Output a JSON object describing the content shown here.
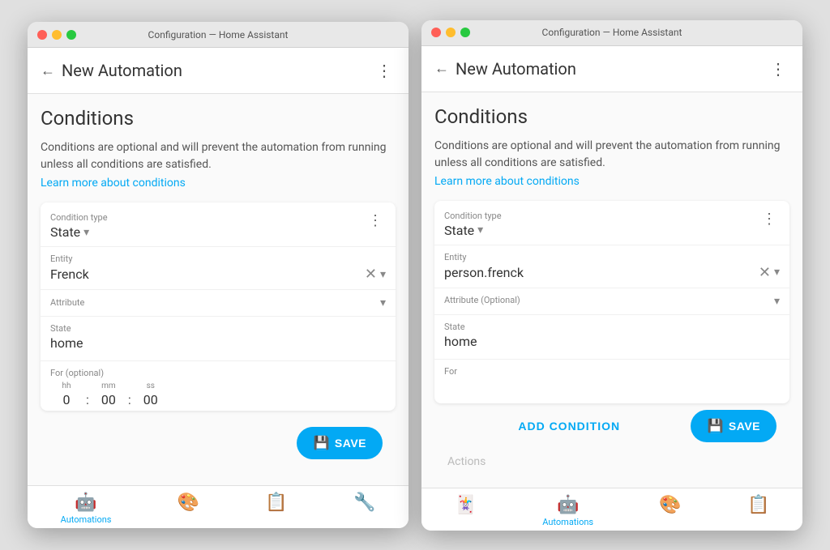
{
  "left_window": {
    "titlebar": "Configuration — Home Assistant",
    "header": {
      "back_label": "New Automation",
      "more_icon": "⋮"
    },
    "section": {
      "title": "Conditions",
      "description": "Conditions are optional and will prevent the automation from running unless all conditions are satisfied.",
      "learn_more": "Learn more about conditions"
    },
    "condition": {
      "type_label": "Condition type",
      "type_value": "State",
      "entity_label": "Entity",
      "entity_value": "Frenck",
      "attribute_label": "Attribute",
      "state_label": "State",
      "state_value": "home",
      "for_label": "For (optional)",
      "hh_label": "hh",
      "hh_value": "0",
      "mm_label": "mm",
      "mm_value": "00",
      "ss_label": "ss",
      "ss_value": "00"
    },
    "save_button": "SAVE",
    "nav": {
      "automations_label": "Automations",
      "nav_items": [
        "🤖",
        "🎨",
        "📋",
        "🔧"
      ]
    }
  },
  "right_window": {
    "titlebar": "Configuration — Home Assistant",
    "header": {
      "back_label": "New Automation",
      "more_icon": "⋮"
    },
    "section": {
      "title": "Conditions",
      "description": "Conditions are optional and will prevent the automation from running unless all conditions are satisfied.",
      "learn_more": "Learn more about conditions"
    },
    "condition": {
      "type_label": "Condition type",
      "type_value": "State",
      "entity_label": "Entity",
      "entity_value": "person.frenck",
      "attribute_label": "Attribute (Optional)",
      "state_label": "State",
      "state_value": "home",
      "for_label": "For",
      "for_placeholder": ""
    },
    "add_condition_label": "ADD CONDITION",
    "save_button": "SAVE",
    "actions_hint": "Actions",
    "nav": {
      "automations_label": "Automations",
      "nav_items": [
        "🃏",
        "🤖",
        "🎨",
        "📋"
      ]
    }
  },
  "icons": {
    "back_arrow": "←",
    "dropdown_arrow": "▾",
    "kebab": "⋮",
    "clear": "✕",
    "save_icon": "💾",
    "robot_icon": "🤖",
    "palette_icon": "🎨",
    "list_icon": "📋",
    "wrench_icon": "🔧",
    "cards_icon": "🃏"
  }
}
